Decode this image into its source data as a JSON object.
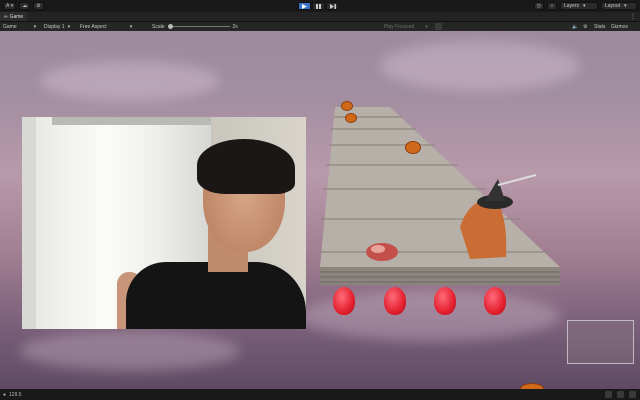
{
  "toolbar": {
    "account_label": "A",
    "layers_label": "Layers",
    "layout_label": "Layout"
  },
  "tab": {
    "title": "Game"
  },
  "gamebar": {
    "mode": "Game",
    "display": "Display 1",
    "aspect": "Free Aspect",
    "scale_label": "Scale",
    "scale_value": "2x",
    "play_focus": "Play Focused",
    "stats_label": "Stats",
    "gizmos_label": "Gizmos"
  },
  "status": {
    "fps": "129.5"
  },
  "colors": {
    "play_active": "#3a72c8",
    "toolbar_bg": "#191919"
  },
  "icons": [
    "cloud-icon",
    "settings-icon",
    "play-icon",
    "pause-icon",
    "step-icon",
    "history-icon",
    "search-icon",
    "audio-icon",
    "more-icon"
  ]
}
